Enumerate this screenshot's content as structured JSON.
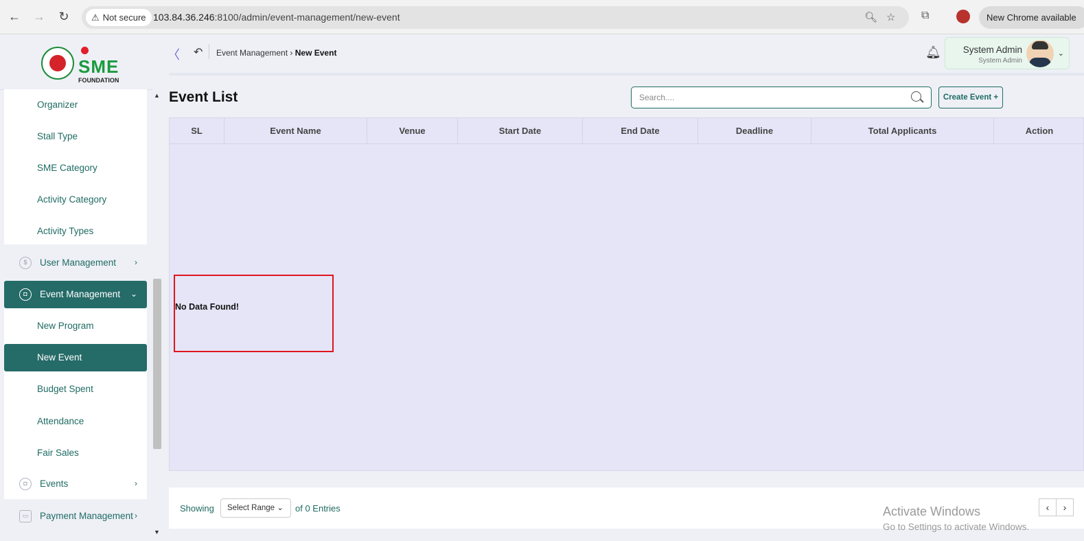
{
  "browser": {
    "security_label": "Not secure",
    "url_host": "103.84.36.246",
    "url_rest": ":8100/admin/event-management/new-event",
    "update_label": "New Chrome available"
  },
  "sidebar": {
    "logo_text": "SME",
    "logo_subtext": "FOUNDATION",
    "sub_items_top": [
      "Organizer",
      "Stall Type",
      "SME Category",
      "Activity Category",
      "Activity Types"
    ],
    "menu": {
      "user_management": "User Management",
      "event_management": "Event Management",
      "events": "Events",
      "payment_management": "Payment Management"
    },
    "event_sub_items": [
      "New Program",
      "New Event",
      "Budget Spent",
      "Attendance",
      "Fair Sales"
    ]
  },
  "topbar": {
    "breadcrumb_parent": "Event Management",
    "breadcrumb_current": "New Event",
    "user_name": "System Admin",
    "user_role": "System Admin"
  },
  "main": {
    "title": "Event List",
    "search_placeholder": "Search....",
    "create_button": "Create Event +",
    "columns": [
      "SL",
      "Event Name",
      "Venue",
      "Start Date",
      "End Date",
      "Deadline",
      "Total Applicants",
      "Action"
    ],
    "empty_message": "No Data Found!"
  },
  "footer": {
    "showing": "Showing",
    "range_label": "Select Range",
    "entries": "of 0 Entries"
  },
  "watermark": {
    "line1": "Activate Windows",
    "line2": "Go to Settings to activate Windows."
  },
  "colors": {
    "accent": "#256b68",
    "table_bg": "#e5e5f7",
    "highlight_border": "#e0141e"
  }
}
